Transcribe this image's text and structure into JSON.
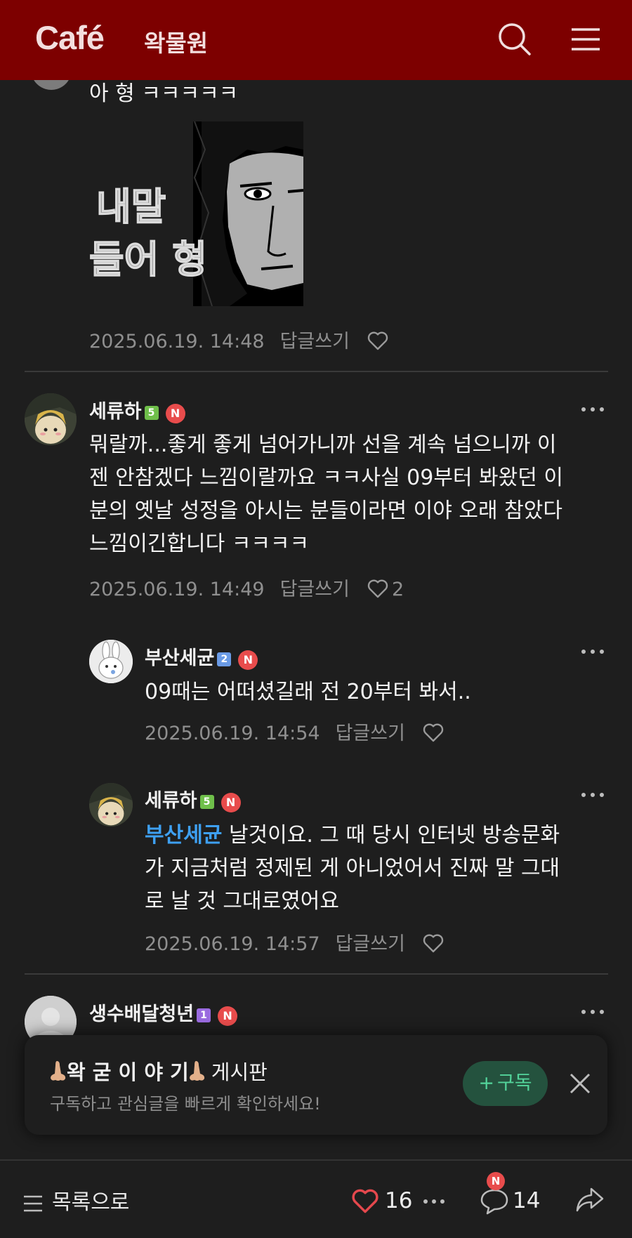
{
  "header": {
    "logo": "Café",
    "cafe_name": "왁물원"
  },
  "comments": [
    {
      "text": "아 형 ㅋㅋㅋㅋㅋ",
      "image_caption": "내말 들어 형",
      "date": "2025.06.19. 14:48",
      "reply": "답글쓰기",
      "likes": ""
    },
    {
      "author": "세류하",
      "level": "5",
      "new_badge": "N",
      "lines": [
        "뭐랄까...좋게 좋게 넘어가니까 선을 계속 넘으니까 이",
        "젠 안참겠다 느낌이랄까요 ㅋㅋ사실 09부터 봐왔던 이",
        "분의 옛날 성정을 아시는 분들이라면 이야 오래 참았다",
        "느낌이긴합니다 ㅋㅋㅋㅋ"
      ],
      "date": "2025.06.19. 14:49",
      "reply": "답글쓰기",
      "likes": "2"
    },
    {
      "author": "부산세균",
      "level": "2",
      "new_badge": "N",
      "text": "09때는 어떠셨길래 전 20부터 봐서..",
      "date": "2025.06.19. 14:54",
      "reply": "답글쓰기",
      "likes": ""
    },
    {
      "author": "세류하",
      "level": "5",
      "new_badge": "N",
      "mention": "부산세균",
      "lines": [
        " 날것이요. 그 때 당시 인터넷 방송문화",
        "가 지금처럼 정제된 게 아니었어서 진짜 말 그대",
        "로 날 것 그대로였어요"
      ],
      "date": "2025.06.19. 14:57",
      "reply": "답글쓰기",
      "likes": ""
    },
    {
      "author": "생수배달청년",
      "level": "1",
      "new_badge": "N"
    }
  ],
  "banner": {
    "title": "왁 굳 이 야 기",
    "board_word": "게시판",
    "subtitle": "구독하고 관심글을 빠르게 확인하세요!",
    "subscribe_label": "구독"
  },
  "bottom_bar": {
    "list_label": "목록으로",
    "likes": "16",
    "comments": "14",
    "comment_badge": "N"
  },
  "colors": {
    "header_bg": "#7d0000",
    "background": "#1e1e1e",
    "mention": "#3ea0f2",
    "badge_n": "#e84c4c",
    "subscribe_bg": "#24523e",
    "subscribe_text": "#53d49b",
    "heart_active": "#e5484d"
  }
}
